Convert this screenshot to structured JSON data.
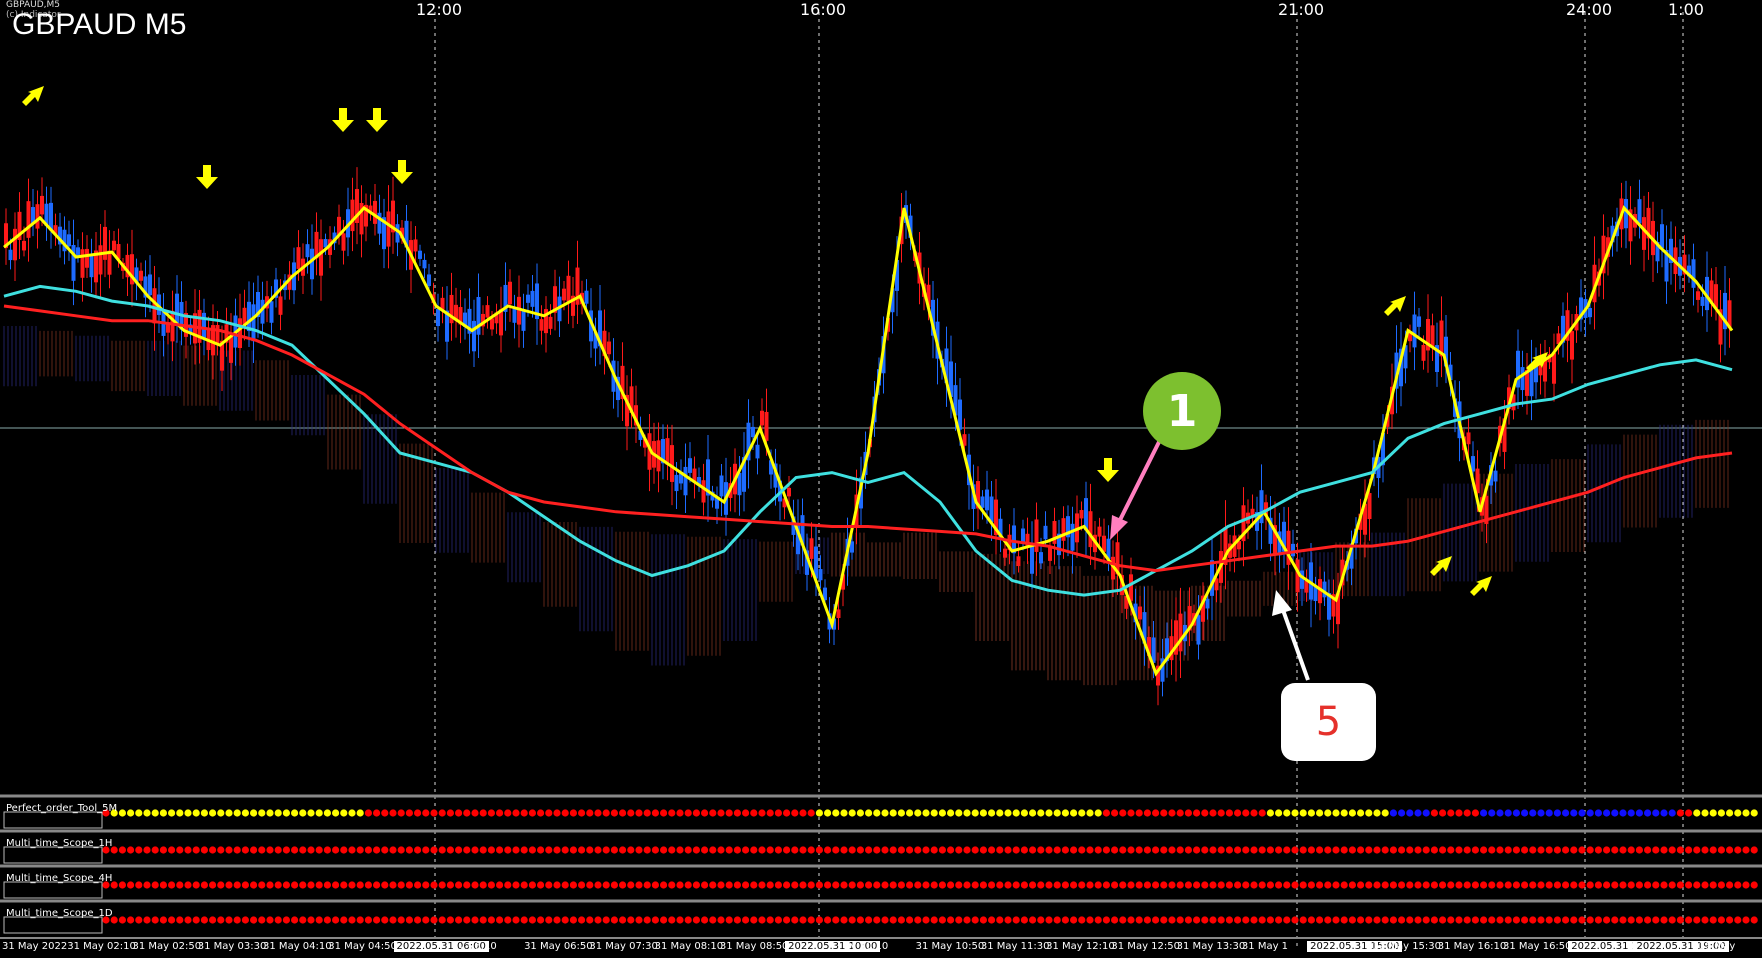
{
  "header": {
    "symbol_small": "GBPAUD,M5",
    "symbol_small2": "(c) Indicator",
    "title": "GBPAUD M5"
  },
  "hour_labels": [
    {
      "text": "12:00"
    },
    {
      "text": "16:00"
    },
    {
      "text": "21:00"
    },
    {
      "text": "24:00"
    },
    {
      "text": "1:00"
    }
  ],
  "panels": [
    {
      "label": "Perfect_order_Tool_5M"
    },
    {
      "label": "Multi_time_Scope_1H"
    },
    {
      "label": "Multi_time_Scope_4H"
    },
    {
      "label": "Multi_time_Scope_1D"
    }
  ],
  "time_axis": [
    "31 May 2022",
    "31 May 02:10",
    "31 May 02:50",
    "31 May 03:30",
    "31 May 04:10",
    "31 May 04:50",
    "2022.05.31 06:00",
    "y 06:10",
    "31 May 06:50",
    "31 May 07:30",
    "31 May 08:10",
    "31 May 08:50",
    "2022.05.31 10:00",
    "y 10:10",
    "31 May 10:50",
    "31 May 11:30",
    "31 May 12:10",
    "31 May 12:50",
    "31 May 13:30",
    "31 May 1",
    "2022.05.31 15:00",
    "31 May 15:30",
    "31 May 16:10",
    "31 May 16:50",
    "2022.05.31 18:00",
    "2022.05.31 19:00",
    "31 May"
  ],
  "annotations": {
    "badge_1": "1",
    "badge_5": "5"
  },
  "colors": {
    "bull": "#1e6bff",
    "bear": "#ff1a1a",
    "yellow_ma": "#ffff00",
    "cyan_ma": "#3fe0e0",
    "red_ma": "#ff2020",
    "dot_red": "#ff0000",
    "dot_yellow": "#ffff00",
    "dot_blue": "#1010ff"
  },
  "chart_data": {
    "type": "line",
    "title": "GBPAUD M5",
    "series": [
      {
        "name": "",
        "values": [
          0.72,
          0.78,
          0.7,
          0.71,
          0.62,
          0.55,
          0.52,
          0.58,
          0.66,
          0.72,
          0.8,
          0.75,
          0.6,
          0.55,
          0.6,
          0.58,
          0.62,
          0.45,
          0.3,
          0.25,
          0.2,
          0.35,
          0.15,
          -0.05,
          0.3,
          0.8,
          0.5,
          0.2,
          0.1,
          0.12,
          0.15,
          0.05,
          -0.15,
          -0.05,
          0.1,
          0.18,
          0.05,
          0.0,
          0.25,
          0.55,
          0.5,
          0.18,
          0.45,
          0.5,
          0.6,
          0.8,
          0.72,
          0.65,
          0.55
        ]
      },
      {
        "name": "",
        "values": [
          0.62,
          0.64,
          0.63,
          0.61,
          0.6,
          0.58,
          0.57,
          0.55,
          0.52,
          0.45,
          0.38,
          0.3,
          0.28,
          0.26,
          0.22,
          0.17,
          0.12,
          0.08,
          0.05,
          0.07,
          0.1,
          0.18,
          0.25,
          0.26,
          0.24,
          0.26,
          0.2,
          0.1,
          0.04,
          0.02,
          0.01,
          0.02,
          0.06,
          0.1,
          0.15,
          0.18,
          0.22,
          0.24,
          0.26,
          0.33,
          0.36,
          0.38,
          0.4,
          0.41,
          0.44,
          0.46,
          0.48,
          0.49,
          0.47
        ]
      },
      {
        "name": "",
        "values": [
          0.6,
          0.59,
          0.58,
          0.57,
          0.57,
          0.56,
          0.55,
          0.53,
          0.5,
          0.46,
          0.42,
          0.36,
          0.31,
          0.26,
          0.22,
          0.2,
          0.19,
          0.18,
          0.175,
          0.17,
          0.165,
          0.16,
          0.155,
          0.15,
          0.15,
          0.145,
          0.14,
          0.135,
          0.12,
          0.11,
          0.09,
          0.07,
          0.06,
          0.07,
          0.08,
          0.09,
          0.1,
          0.11,
          0.11,
          0.12,
          0.14,
          0.16,
          0.18,
          0.2,
          0.22,
          0.25,
          0.27,
          0.29,
          0.3
        ]
      }
    ],
    "dot_rows": [
      {
        "pattern": "Perfect_order_Tool_5M"
      },
      {
        "pattern": "Multi_time_Scope_1H"
      },
      {
        "pattern": "Multi_time_Scope_4H"
      },
      {
        "pattern": "Multi_time_Scope_1D"
      }
    ]
  }
}
